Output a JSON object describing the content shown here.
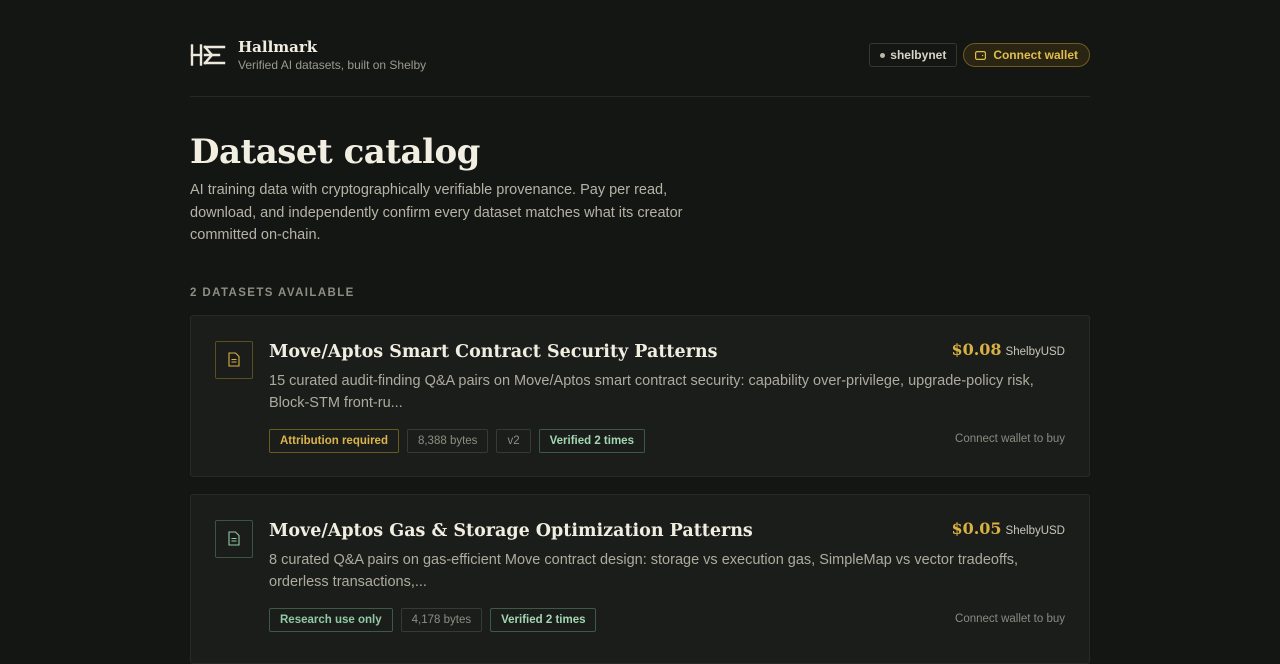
{
  "header": {
    "brand_title": "Hallmark",
    "brand_subtitle": "Verified AI datasets, built on Shelby",
    "network": "shelbynet",
    "connect_wallet": "Connect wallet"
  },
  "hero": {
    "title": "Dataset catalog",
    "description": "AI training data with cryptographically verifiable provenance. Pay per read, download, and independently confirm every dataset matches what its creator committed on-chain.",
    "count_label": "2 DATASETS AVAILABLE"
  },
  "datasets": [
    {
      "title": "Move/Aptos Smart Contract Security Patterns",
      "price": "$0.08",
      "currency": "ShelbyUSD",
      "description": "15 curated audit-finding Q&A pairs on Move/Aptos smart contract security: capability over-privilege, upgrade-policy risk, Block-STM front-ru...",
      "license": "Attribution required",
      "size": "8,388 bytes",
      "version": "v2",
      "verified": "Verified 2 times",
      "buy_hint": "Connect wallet to buy",
      "icon": "document-icon",
      "accent": "#d9b043"
    },
    {
      "title": "Move/Aptos Gas & Storage Optimization Patterns",
      "price": "$0.05",
      "currency": "ShelbyUSD",
      "description": "8 curated Q&A pairs on gas-efficient Move contract design: storage vs execution gas, SimpleMap vs vector tradeoffs, orderless transactions,...",
      "license": "Research use only",
      "size": "4,178 bytes",
      "verified": "Verified 2 times",
      "buy_hint": "Connect wallet to buy",
      "icon": "document-icon",
      "accent": "#91c9a4"
    }
  ]
}
